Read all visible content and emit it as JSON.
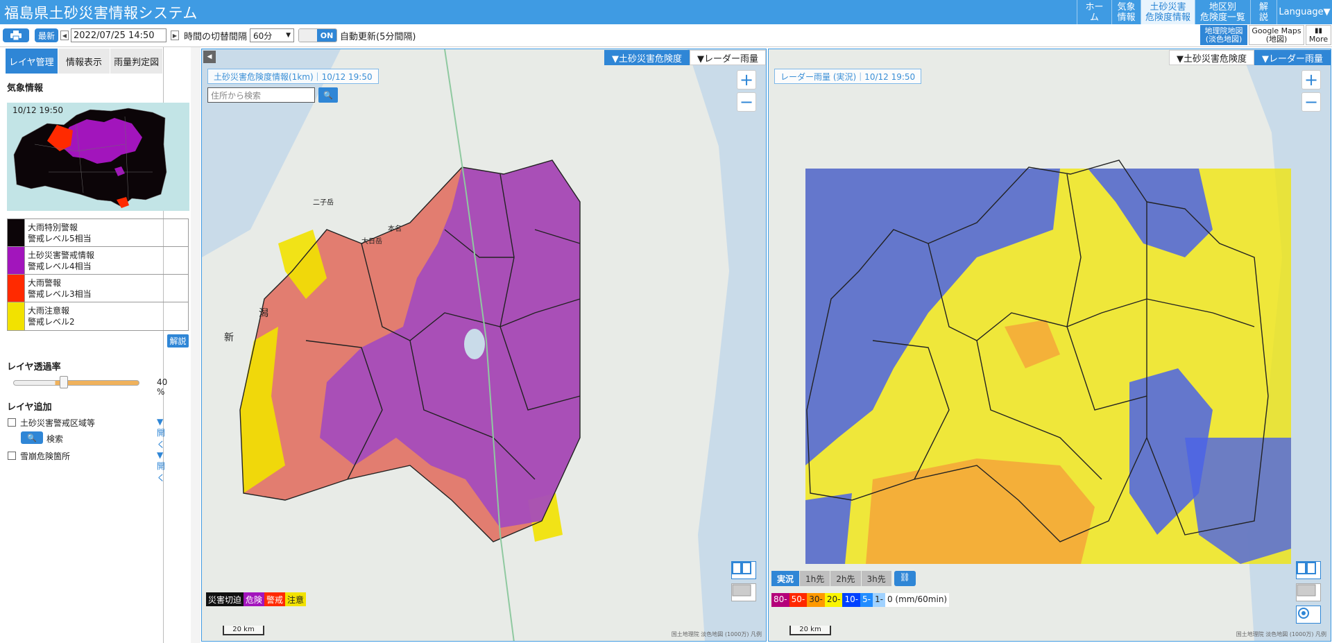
{
  "header": {
    "title": "福島県土砂災害情報システム",
    "nav": [
      "ホーム",
      "気象\n情報",
      "土砂災害\n危険度情報",
      "地区別\n危険度一覧",
      "解説",
      "Language▼"
    ]
  },
  "toolbar": {
    "latest": "最新",
    "datetime": "2022/07/25 14:50",
    "interval_label": "時間の切替間隔",
    "interval_value": "60分",
    "toggle": "ON",
    "auto_update": "自動更新(5分間隔)",
    "gsi_map": "地理院地図\n(淡色地図)",
    "google_maps": "Google Maps\n(地図)",
    "more": "More"
  },
  "sidebar": {
    "tabs": [
      "レイヤ管理",
      "情報表示",
      "雨量判定図"
    ],
    "weather_title": "気象情報",
    "mini_time": "10/12 19:50",
    "legend": [
      {
        "label": "大雨特別警報\n警戒レベル5相当",
        "color": "#0c0508"
      },
      {
        "label": "土砂災害警戒情報\n警戒レベル4相当",
        "color": "#a215bc"
      },
      {
        "label": "大雨警報\n警戒レベル3相当",
        "color": "#ff2a00"
      },
      {
        "label": "大雨注意報\n警戒レベル2",
        "color": "#f2e200"
      }
    ],
    "explain": "解説",
    "opacity_title": "レイヤ透過率",
    "opacity_value": "40 %",
    "opacity_level": 0.4,
    "add_title": "レイヤ追加",
    "layer1": "土砂災害警戒区域等",
    "open": "▼ 開く",
    "search": "検索",
    "layer2": "雪崩危険箇所"
  },
  "map_left": {
    "tab_risk": "▼土砂災害危険度",
    "tab_radar": "▼レーダー雨量",
    "info": "土砂災害危険度情報(1km)｜10/12 19:50",
    "search_placeholder": "住所から検索",
    "legend": [
      {
        "label": "災害切迫",
        "color": "#111111"
      },
      {
        "label": "危険",
        "color": "#a215bc"
      },
      {
        "label": "警戒",
        "color": "#ff2a00"
      },
      {
        "label": "注意",
        "color": "#f2e200"
      }
    ],
    "scale": "20 km",
    "credits": "国土地理院 淡色地図 (1000万) 凡例",
    "places": [
      "新",
      "潟",
      "二子岳",
      "大日岳",
      "本名"
    ]
  },
  "map_right": {
    "tab_risk": "▼土砂災害危険度",
    "tab_radar": "▼レーダー雨量",
    "info": "レーダー雨量 (実況)｜10/12 19:50",
    "forecast_tabs": [
      "実況",
      "1h先",
      "2h先",
      "3h先"
    ],
    "rain_legend": [
      {
        "label": "80-",
        "color": "#b4007a"
      },
      {
        "label": "50-",
        "color": "#ff2800"
      },
      {
        "label": "30-",
        "color": "#ff9900"
      },
      {
        "label": "20-",
        "color": "#faf500"
      },
      {
        "label": "10-",
        "color": "#0041ff"
      },
      {
        "label": "5-",
        "color": "#218cff"
      },
      {
        "label": "1-",
        "color": "#a0d2ff"
      }
    ],
    "rain_zero": "0 (mm/60min)",
    "scale": "20 km",
    "credits": "国土地理院 淡色地図 (1000万) 凡例"
  }
}
